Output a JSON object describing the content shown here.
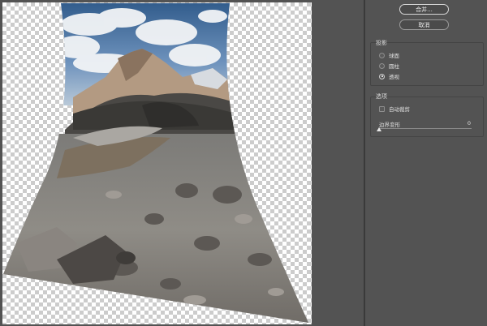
{
  "buttons": {
    "merge_label": "合并...",
    "cancel_label": "取消"
  },
  "projection": {
    "title": "投影",
    "options": [
      {
        "label": "球面",
        "selected": false
      },
      {
        "label": "圆柱",
        "selected": false
      },
      {
        "label": "透视",
        "selected": true
      }
    ]
  },
  "options": {
    "title": "选项",
    "auto_crop_label": "自动裁剪",
    "auto_crop_checked": false,
    "boundary_warp_label": "边界变形",
    "boundary_warp_value": "0",
    "boundary_warp_fraction": 0
  },
  "colors": {
    "panel_bg": "#535353",
    "checker_light": "#ffffff",
    "checker_dark": "#cccccc"
  }
}
